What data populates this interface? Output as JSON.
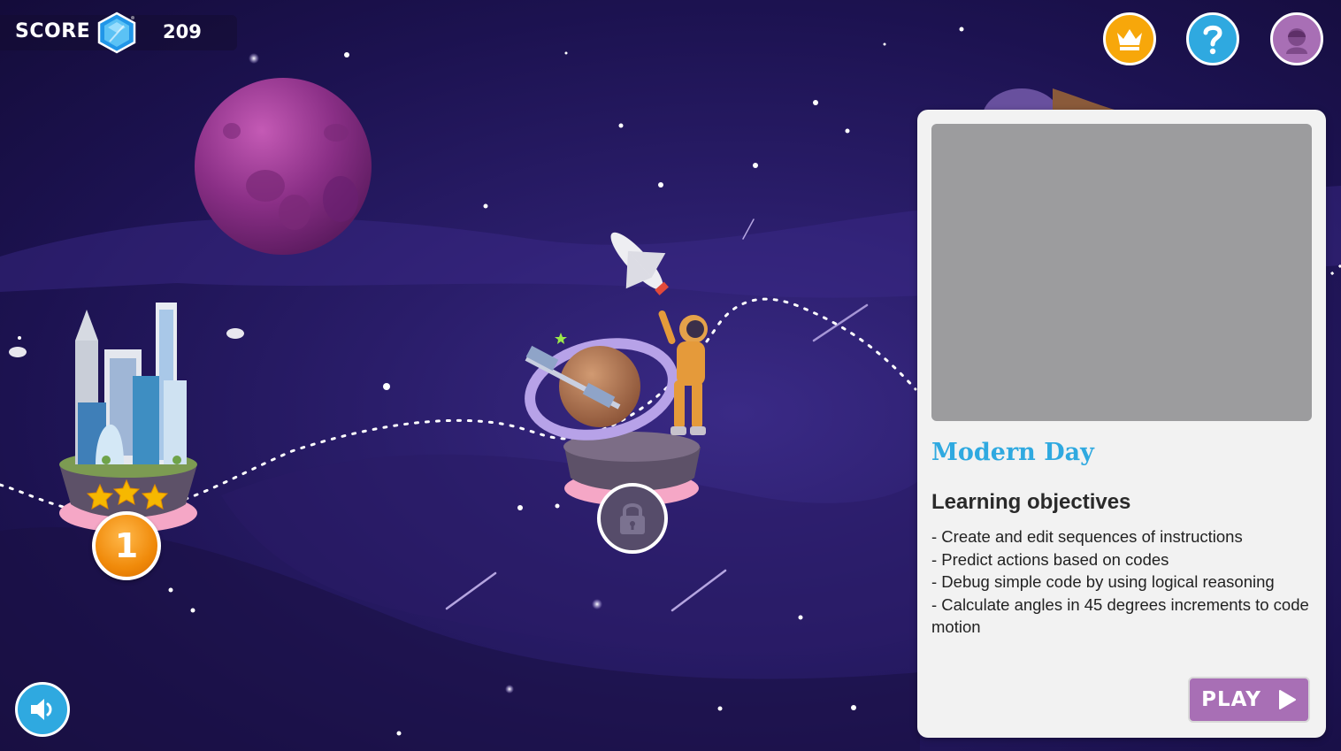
{
  "hud": {
    "score_label": "SCORE",
    "score_value": "209",
    "gem_icon": "blue-gem-icon"
  },
  "top_buttons": {
    "leaderboard": "crown-icon",
    "help": "question-mark-icon",
    "profile": "avatar-icon"
  },
  "sound": {
    "icon": "speaker-icon"
  },
  "levels": [
    {
      "number": "1",
      "stars": 3,
      "state": "unlocked",
      "theme": "city"
    },
    {
      "state": "locked",
      "theme": "space"
    }
  ],
  "panel": {
    "title": "Modern Day",
    "objectives_heading": "Learning objectives",
    "objectives": [
      "- Create and edit sequences of instructions",
      "- Predict actions based on codes",
      "- Debug simple code by using logical reasoning",
      "- Calculate angles in 45 degrees increments to code motion"
    ],
    "play_label": "PLAY"
  },
  "colors": {
    "accent_blue": "#2fa9e0",
    "accent_purple": "#a86fb5",
    "accent_orange": "#f7a70a",
    "background": "#2a1d6a"
  }
}
